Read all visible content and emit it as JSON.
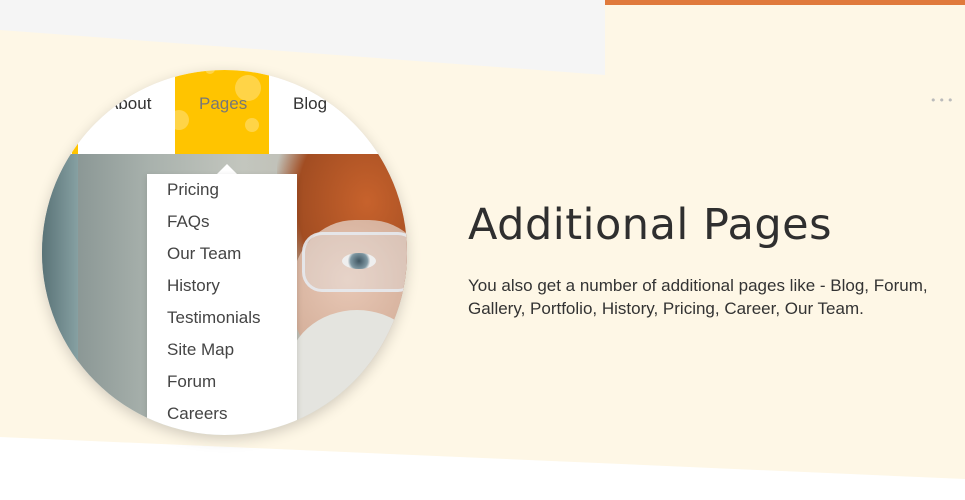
{
  "nav": {
    "items": [
      {
        "label": "About"
      },
      {
        "label": "Pages"
      },
      {
        "label": "Blog"
      }
    ]
  },
  "dropdown": {
    "items": [
      "Pricing",
      "FAQs",
      "Our Team",
      "History",
      "Testimonials",
      "Site Map",
      "Forum",
      "Careers"
    ]
  },
  "feature": {
    "title": "Additional Pages",
    "description": "You also get a number of additional pages like - Blog, Forum, Gallery, Portfolio, History, Pricing, Career, Our Team."
  },
  "icons": {
    "more": "more-dots-icon"
  },
  "colors": {
    "accent": "#ffc400",
    "background": "#fef7e6",
    "orange_strip": "#e07a3c"
  }
}
